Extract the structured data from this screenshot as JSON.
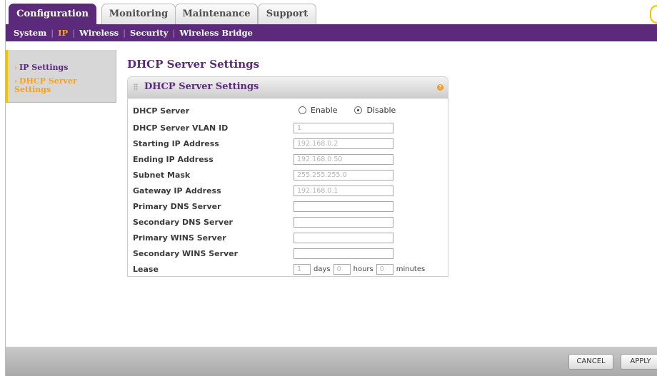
{
  "tabs": [
    "Configuration",
    "Monitoring",
    "Maintenance",
    "Support"
  ],
  "subnav": [
    "System",
    "IP",
    "Wireless",
    "Security",
    "Wireless Bridge"
  ],
  "sidebar": {
    "items": [
      "IP Settings",
      "DHCP Server",
      "Settings"
    ]
  },
  "page_title": "DHCP Server Settings",
  "panel": {
    "title": "DHCP Server Settings",
    "help_icon": "help-icon",
    "dhcp_server": {
      "label": "DHCP Server",
      "enable": "Enable",
      "disable": "Disable",
      "selected": "Disable"
    },
    "fields": [
      {
        "label": "DHCP Server VLAN ID",
        "value": "1"
      },
      {
        "label": "Starting IP Address",
        "value": "192.168.0.2"
      },
      {
        "label": "Ending IP Address",
        "value": "192.168.0.50"
      },
      {
        "label": "Subnet Mask",
        "value": "255.255.255.0"
      },
      {
        "label": "Gateway IP Address",
        "value": "192.168.0.1"
      },
      {
        "label": "Primary DNS Server",
        "value": ""
      },
      {
        "label": "Secondary DNS Server",
        "value": ""
      },
      {
        "label": "Primary WINS Server",
        "value": ""
      },
      {
        "label": "Secondary WINS Server",
        "value": ""
      }
    ],
    "lease": {
      "label": "Lease",
      "days": "1",
      "days_unit": "days",
      "hours": "0",
      "hours_unit": "hours",
      "minutes": "0",
      "minutes_unit": "minutes"
    }
  },
  "footer": {
    "cancel": "CANCEL",
    "apply": "APPLY"
  },
  "colors": {
    "brand_purple": "#5c2a7b",
    "accent_orange": "#f7a21b"
  }
}
